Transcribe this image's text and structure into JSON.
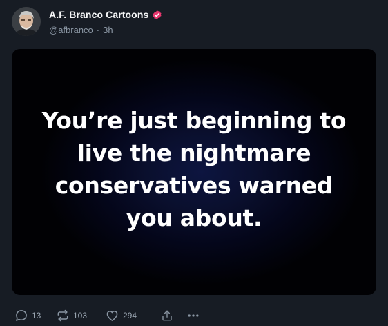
{
  "post": {
    "author_name": "A.F. Branco Cartoons",
    "handle": "@afbranco",
    "separator": "·",
    "time": "3h",
    "verified": true,
    "avatar": "avatar-man-gray-hair",
    "media": {
      "quote_lines": [
        "You’re just beginning to",
        "live the nightmare",
        "conservatives warned",
        "you about."
      ]
    },
    "actions": {
      "replies": {
        "icon": "reply-icon",
        "count": "13"
      },
      "reposts": {
        "icon": "repost-icon",
        "count": "103"
      },
      "likes": {
        "icon": "heart-icon",
        "count": "294"
      },
      "share": {
        "icon": "share-icon"
      },
      "more": {
        "icon": "more-icon"
      }
    }
  },
  "colors": {
    "background": "#171c24",
    "text_primary": "#f5f6f7",
    "text_secondary": "#8b97a4",
    "badge": "#e8386f",
    "media_text": "#ffffff"
  }
}
